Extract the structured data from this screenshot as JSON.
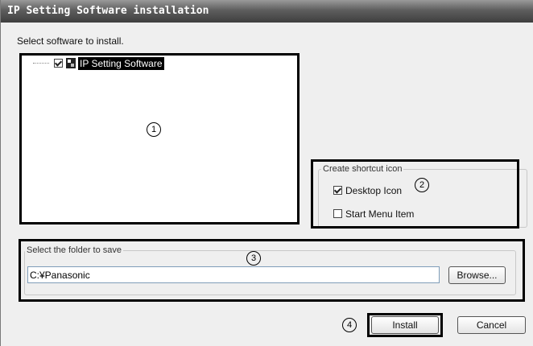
{
  "window": {
    "title": "IP Setting Software installation"
  },
  "tree": {
    "heading": "Select software to install.",
    "item": {
      "label": "IP Setting Software",
      "checked": true,
      "icon": "software-package-icon"
    }
  },
  "shortcut": {
    "title": "Create shortcut icon",
    "desktop_label": "Desktop Icon",
    "desktop_checked": true,
    "startmenu_label": "Start Menu Item",
    "startmenu_checked": false
  },
  "folder": {
    "title": "Select the folder to save",
    "path": "C:¥Panasonic",
    "browse_label": "Browse..."
  },
  "buttons": {
    "install_label": "Install",
    "cancel_label": "Cancel"
  },
  "markers": {
    "m1": "1",
    "m2": "2",
    "m3": "3",
    "m4": "4"
  }
}
